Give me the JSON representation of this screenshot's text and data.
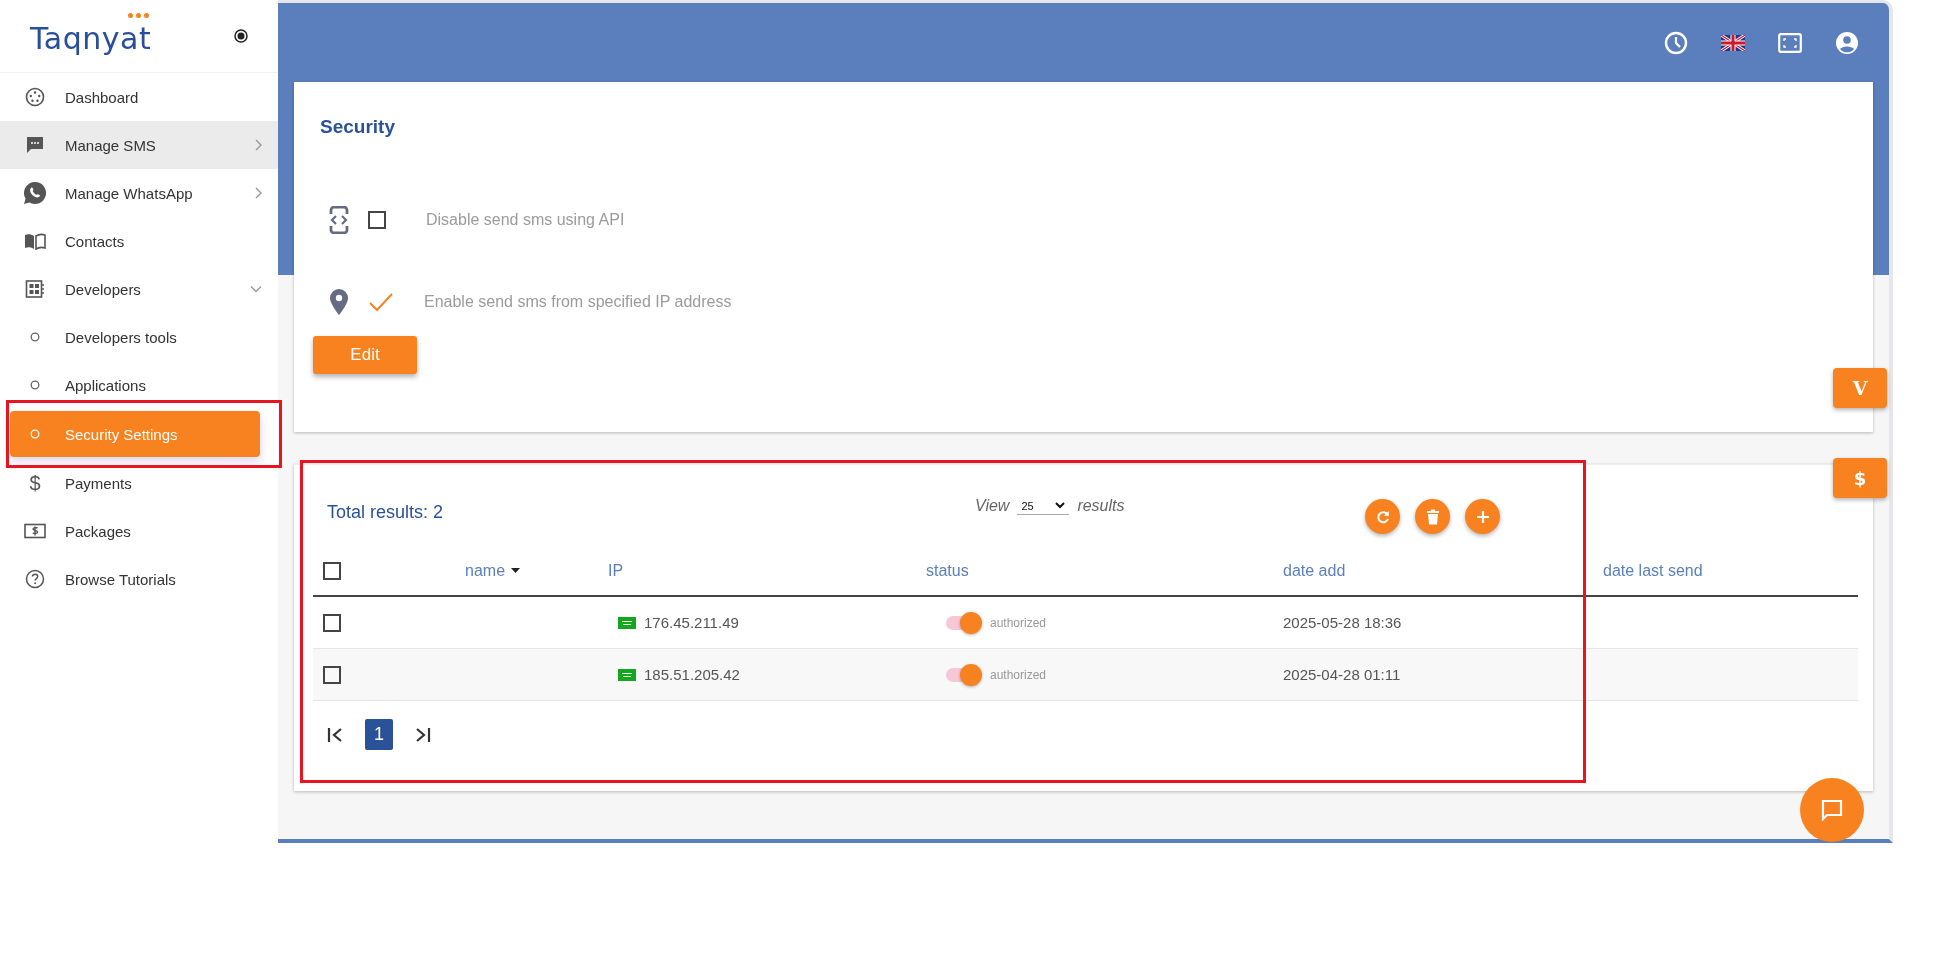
{
  "logo": {
    "text": "Taqnyat"
  },
  "sidebar": {
    "items": [
      {
        "label": "Dashboard",
        "highlighted": false,
        "selected": false
      },
      {
        "label": "Manage SMS",
        "highlighted": true,
        "selected": false,
        "expanded": false
      },
      {
        "label": "Manage WhatsApp",
        "highlighted": false,
        "selected": false,
        "expanded": false
      },
      {
        "label": "Contacts",
        "highlighted": false,
        "selected": false
      },
      {
        "label": "Developers",
        "highlighted": false,
        "selected": false,
        "expanded": true,
        "children": [
          {
            "label": "Developers tools",
            "highlighted": false,
            "selected": false
          },
          {
            "label": "Applications",
            "highlighted": false,
            "selected": false
          },
          {
            "label": "Security Settings",
            "highlighted": false,
            "selected": true
          }
        ]
      },
      {
        "label": "Payments",
        "glyph": "$",
        "highlighted": false,
        "selected": false
      },
      {
        "label": "Packages",
        "highlighted": false,
        "selected": false
      },
      {
        "label": "Browse Tutorials",
        "highlighted": false,
        "selected": false
      }
    ]
  },
  "security": {
    "title": "Security",
    "options": [
      {
        "kind": "code",
        "label": "Disable send sms using API",
        "checked": false
      },
      {
        "kind": "pin",
        "label": "Enable send sms from specified IP address",
        "checked": true
      }
    ],
    "edit_button": "Edit"
  },
  "side_buttons": [
    "V",
    "$"
  ],
  "table": {
    "total": "Total results: 2",
    "view": {
      "before": "View",
      "value": "25",
      "after": "results"
    },
    "actions": [
      {
        "kind": "refresh"
      },
      {
        "kind": "delete"
      },
      {
        "kind": "add"
      }
    ],
    "select_all": {
      "checked": false
    },
    "columns": [
      {
        "label": "name",
        "sorted": true
      },
      {
        "label": "IP",
        "sorted": false
      },
      {
        "label": "status",
        "sorted": false
      },
      {
        "label": "date add",
        "sorted": false
      },
      {
        "label": "date last send",
        "sorted": false
      }
    ],
    "rows": [
      {
        "checked": false,
        "ip": "176.45.211.49",
        "status": "authorized",
        "on": true,
        "date_add": "2025-05-28 18:36"
      },
      {
        "checked": false,
        "ip": "185.51.205.42",
        "status": "authorized",
        "on": true,
        "date_add": "2025-04-28 01:11"
      }
    ],
    "pagination": {
      "pages": [
        {
          "label": "1",
          "selected": true
        }
      ]
    }
  }
}
